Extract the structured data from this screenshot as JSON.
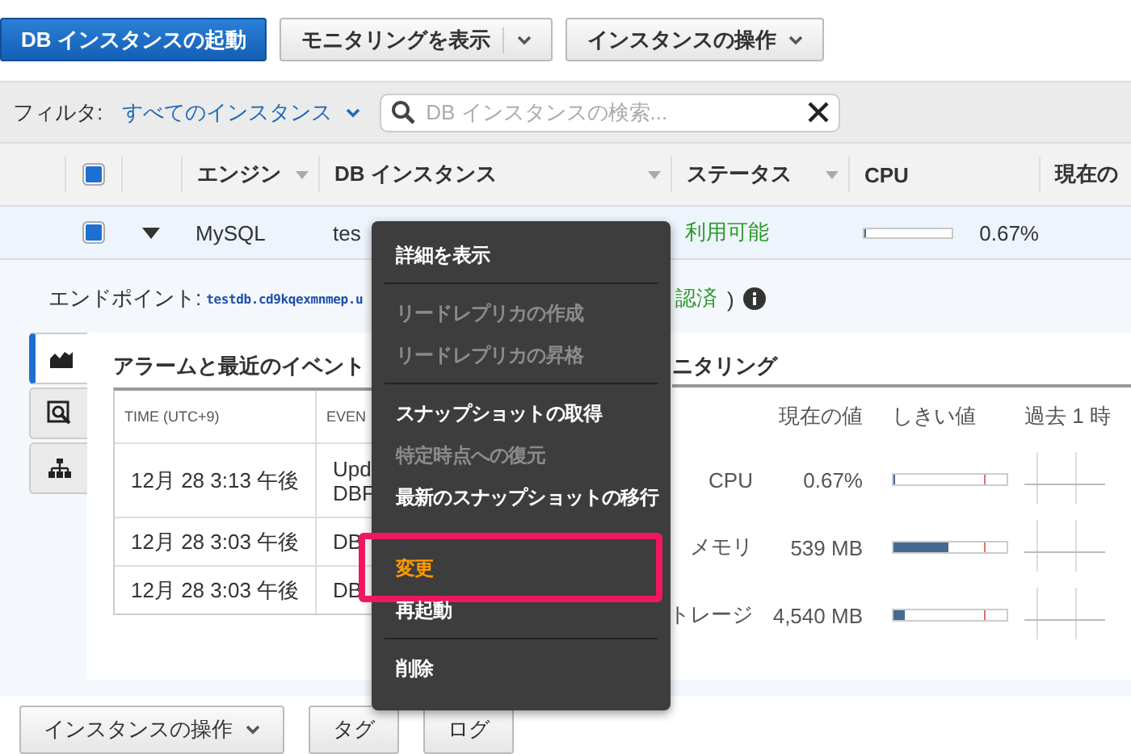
{
  "toolbar": {
    "launch_button": "DB インスタンスの起動",
    "monitoring_button": "モニタリングを表示",
    "actions_button": "インスタンスの操作"
  },
  "filter": {
    "label": "フィルタ:",
    "value": "すべてのインスタンス",
    "search": {
      "placeholder": "DB インスタンスの検索..."
    }
  },
  "table": {
    "header_checked": true,
    "columns": [
      {
        "label": "エンジン",
        "sortable": true
      },
      {
        "label": "DB インスタンス",
        "sortable": true
      },
      {
        "label": "ステータス",
        "sortable": true
      },
      {
        "label": "CPU",
        "sortable": false
      },
      {
        "label": "現在の",
        "sortable": false
      }
    ],
    "rows": [
      {
        "checked": true,
        "expanded": true,
        "engine": "MySQL",
        "instance": "tes",
        "status": "利用可能",
        "level": 0.0067,
        "cpu": "0.67%"
      }
    ]
  },
  "details": {
    "endpoint_label": "エンドポイント:",
    "endpoint": "testdb.cd9kqexmnmep.u",
    "endpoint_status": "認済",
    "endpoint_paren": ")",
    "side_tabs": [
      {
        "kind": "chart",
        "selected": true
      },
      {
        "kind": "search",
        "selected": false
      },
      {
        "kind": "hierarchy",
        "selected": false
      }
    ],
    "events": {
      "title": "アラームと最近のイベント",
      "columns": [
        "TIME (UTC+9)",
        "EVEN"
      ],
      "rows": [
        {
          "time": "12月 28 3:13 午後",
          "event": [
            "Upd",
            "DBF"
          ]
        },
        {
          "time": "12月 28 3:03 午後",
          "event": [
            "DB"
          ]
        },
        {
          "time": "12月 28 3:03 午後",
          "event": [
            "DB"
          ]
        }
      ]
    },
    "monitoring": {
      "title": "ニタリング",
      "columns": [
        "現在の値",
        "しきい値",
        "過去 1 時"
      ],
      "metrics": [
        {
          "name": "CPU",
          "value": "0.67%",
          "level": 0.0067
        },
        {
          "name": "メモリ",
          "value": "539 MB",
          "level": 0.48
        },
        {
          "name": "トレージ",
          "value": "4,540 MB",
          "level": 0.1
        }
      ]
    }
  },
  "bottom_buttons": [
    {
      "label": "インスタンスの操作",
      "dropdown": true
    },
    {
      "label": "タグ",
      "dropdown": false
    },
    {
      "label": "ログ",
      "dropdown": false
    }
  ],
  "context_menu": {
    "items": [
      {
        "kind": "item",
        "label": "詳細を表示",
        "disabled": false,
        "highlighted": false
      },
      {
        "kind": "divider"
      },
      {
        "kind": "item",
        "label": "リードレプリカの作成",
        "disabled": true,
        "highlighted": false
      },
      {
        "kind": "item",
        "label": "リードレプリカの昇格",
        "disabled": true,
        "highlighted": false
      },
      {
        "kind": "divider"
      },
      {
        "kind": "item",
        "label": "スナップショットの取得",
        "disabled": false,
        "highlighted": false
      },
      {
        "kind": "item",
        "label": "特定時点への復元",
        "disabled": true,
        "highlighted": false
      },
      {
        "kind": "item",
        "label": "最新のスナップショットの移行",
        "disabled": false,
        "highlighted": false
      },
      {
        "kind": "spacer"
      },
      {
        "kind": "item",
        "label": "変更",
        "disabled": false,
        "highlighted": true
      },
      {
        "kind": "item",
        "label": "再起動",
        "disabled": false,
        "highlighted": false
      },
      {
        "kind": "divider"
      },
      {
        "kind": "item",
        "label": "削除",
        "disabled": false,
        "highlighted": false
      }
    ]
  }
}
